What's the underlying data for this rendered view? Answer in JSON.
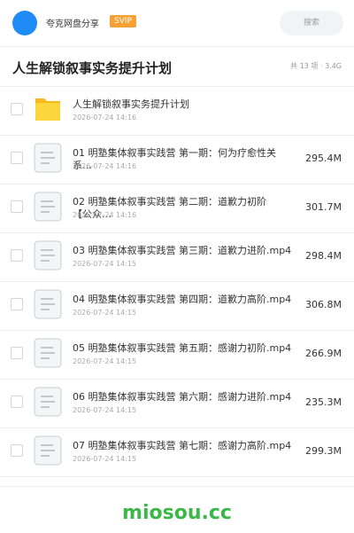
{
  "header": {
    "share_name": "夸克网盘分享",
    "badge": "SVIP",
    "search_placeholder": "搜索",
    "avatar_color": "#1f8bf6",
    "badge_color": "#f7a135"
  },
  "folder": {
    "title": "人生解锁叙事实务提升计划",
    "meta": "共 13 项 · 3.4G"
  },
  "files": [
    {
      "icon": "folder-icon",
      "name": "人生解锁叙事实务提升计划",
      "date": "2026-07-24 14:16",
      "size": ""
    },
    {
      "icon": "document-icon",
      "name": "01 明塾集体叙事实践营 第一期：何为疗愈性关系…",
      "date": "2026-07-24 14:16",
      "size": "295.4M"
    },
    {
      "icon": "document-icon",
      "name": "02 明塾集体叙事实践营 第二期：道歉力初阶【公众…",
      "date": "2026-07-24 14:16",
      "size": "301.7M"
    },
    {
      "icon": "document-icon",
      "name": "03 明塾集体叙事实践营 第三期：道歉力进阶.mp4",
      "date": "2026-07-24 14:15",
      "size": "298.4M"
    },
    {
      "icon": "document-icon",
      "name": "04 明塾集体叙事实践营 第四期：道歉力高阶.mp4",
      "date": "2026-07-24 14:15",
      "size": "306.8M"
    },
    {
      "icon": "document-icon",
      "name": "05 明塾集体叙事实践营 第五期：感谢力初阶.mp4",
      "date": "2026-07-24 14:15",
      "size": "266.9M"
    },
    {
      "icon": "document-icon",
      "name": "06 明塾集体叙事实践营 第六期：感谢力进阶.mp4",
      "date": "2026-07-24 14:15",
      "size": "235.3M"
    },
    {
      "icon": "document-icon",
      "name": "07 明塾集体叙事实践营 第七期：感谢力高阶.mp4",
      "date": "2026-07-24 14:15",
      "size": "299.3M"
    }
  ],
  "watermark": "miosou.cc",
  "colors": {
    "folder": "#fbc531",
    "watermark": "#3cb84a"
  }
}
